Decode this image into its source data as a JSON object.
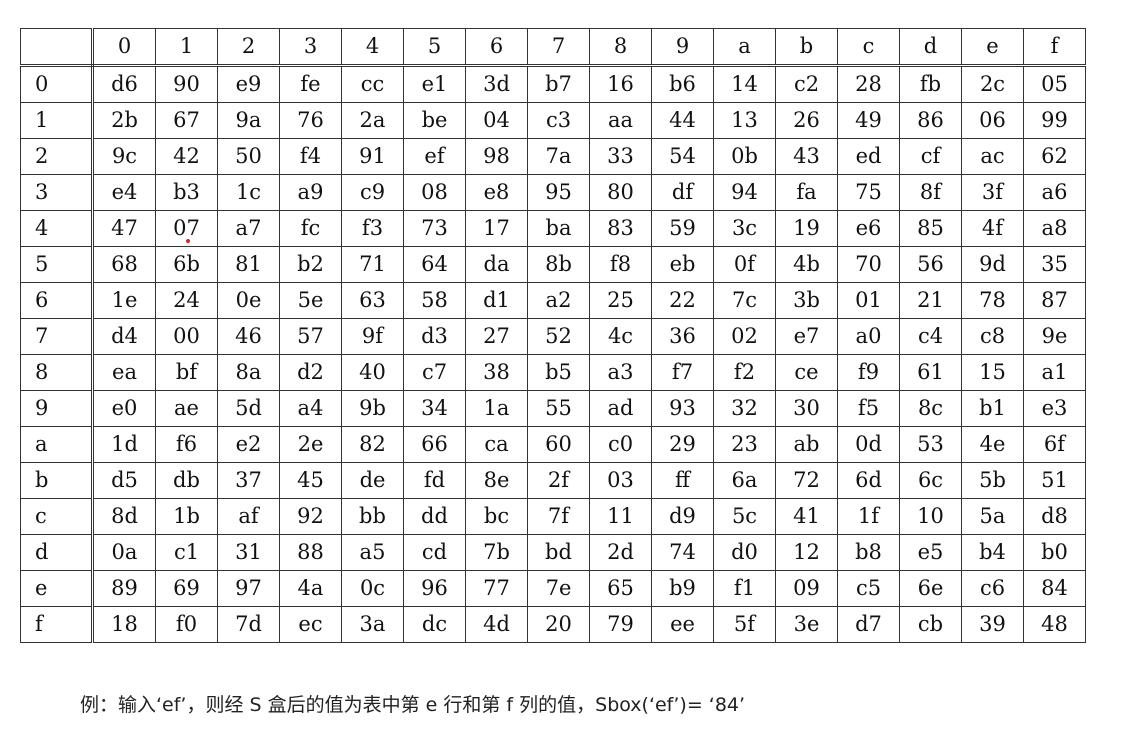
{
  "table": {
    "corner": "",
    "col_headers": [
      "0",
      "1",
      "2",
      "3",
      "4",
      "5",
      "6",
      "7",
      "8",
      "9",
      "a",
      "b",
      "c",
      "d",
      "e",
      "f"
    ],
    "row_headers": [
      "0",
      "1",
      "2",
      "3",
      "4",
      "5",
      "6",
      "7",
      "8",
      "9",
      "a",
      "b",
      "c",
      "d",
      "e",
      "f"
    ],
    "rows": [
      [
        "d6",
        "90",
        "e9",
        "fe",
        "cc",
        "e1",
        "3d",
        "b7",
        "16",
        "b6",
        "14",
        "c2",
        "28",
        "fb",
        "2c",
        "05"
      ],
      [
        "2b",
        "67",
        "9a",
        "76",
        "2a",
        "be",
        "04",
        "c3",
        "aa",
        "44",
        "13",
        "26",
        "49",
        "86",
        "06",
        "99"
      ],
      [
        "9c",
        "42",
        "50",
        "f4",
        "91",
        "ef",
        "98",
        "7a",
        "33",
        "54",
        "0b",
        "43",
        "ed",
        "cf",
        "ac",
        "62"
      ],
      [
        "e4",
        "b3",
        "1c",
        "a9",
        "c9",
        "08",
        "e8",
        "95",
        "80",
        "df",
        "94",
        "fa",
        "75",
        "8f",
        "3f",
        "a6"
      ],
      [
        "47",
        "07",
        "a7",
        "fc",
        "f3",
        "73",
        "17",
        "ba",
        "83",
        "59",
        "3c",
        "19",
        "e6",
        "85",
        "4f",
        "a8"
      ],
      [
        "68",
        "6b",
        "81",
        "b2",
        "71",
        "64",
        "da",
        "8b",
        "f8",
        "eb",
        "0f",
        "4b",
        "70",
        "56",
        "9d",
        "35"
      ],
      [
        "1e",
        "24",
        "0e",
        "5e",
        "63",
        "58",
        "d1",
        "a2",
        "25",
        "22",
        "7c",
        "3b",
        "01",
        "21",
        "78",
        "87"
      ],
      [
        "d4",
        "00",
        "46",
        "57",
        "9f",
        "d3",
        "27",
        "52",
        "4c",
        "36",
        "02",
        "e7",
        "a0",
        "c4",
        "c8",
        "9e"
      ],
      [
        "ea",
        "bf",
        "8a",
        "d2",
        "40",
        "c7",
        "38",
        "b5",
        "a3",
        "f7",
        "f2",
        "ce",
        "f9",
        "61",
        "15",
        "a1"
      ],
      [
        "e0",
        "ae",
        "5d",
        "a4",
        "9b",
        "34",
        "1a",
        "55",
        "ad",
        "93",
        "32",
        "30",
        "f5",
        "8c",
        "b1",
        "e3"
      ],
      [
        "1d",
        "f6",
        "e2",
        "2e",
        "82",
        "66",
        "ca",
        "60",
        "c0",
        "29",
        "23",
        "ab",
        "0d",
        "53",
        "4e",
        "6f"
      ],
      [
        "d5",
        "db",
        "37",
        "45",
        "de",
        "fd",
        "8e",
        "2f",
        "03",
        "ff",
        "6a",
        "72",
        "6d",
        "6c",
        "5b",
        "51"
      ],
      [
        "8d",
        "1b",
        "af",
        "92",
        "bb",
        "dd",
        "bc",
        "7f",
        "11",
        "d9",
        "5c",
        "41",
        "1f",
        "10",
        "5a",
        "d8"
      ],
      [
        "0a",
        "c1",
        "31",
        "88",
        "a5",
        "cd",
        "7b",
        "bd",
        "2d",
        "74",
        "d0",
        "12",
        "b8",
        "e5",
        "b4",
        "b0"
      ],
      [
        "89",
        "69",
        "97",
        "4a",
        "0c",
        "96",
        "77",
        "7e",
        "65",
        "b9",
        "f1",
        "09",
        "c5",
        "6e",
        "c6",
        "84"
      ],
      [
        "18",
        "f0",
        "7d",
        "ec",
        "3a",
        "dc",
        "4d",
        "20",
        "79",
        "ee",
        "5f",
        "3e",
        "d7",
        "cb",
        "39",
        "48"
      ]
    ]
  },
  "caption": "例：输入‘ef’，则经 S 盒后的值为表中第 e 行和第 f 列的值，Sbox(‘ef’)= ‘84’"
}
